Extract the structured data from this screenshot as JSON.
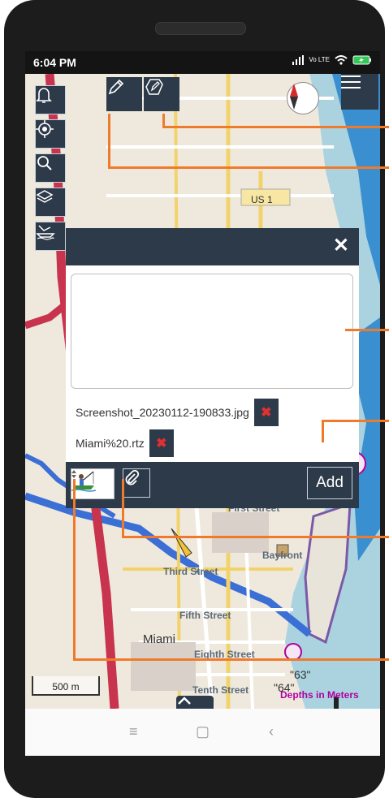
{
  "status_bar": {
    "time": "6:04 PM",
    "network": "Vo LTE",
    "icons": [
      "signal-icon",
      "wifi-icon",
      "battery-charging-icon"
    ]
  },
  "map": {
    "labels": {
      "us1": "US 1",
      "miami": "Miami",
      "third_street": "Third Street",
      "fifth_street": "Fifth Street",
      "eighth_street": "Eighth Street",
      "tenth_street": "Tenth Street",
      "first_street": "First Street",
      "bayfront": "Bayfront",
      "depth_63": "\"63\"",
      "depth_64": "\"64\""
    },
    "scale_label": "500 m",
    "depths_label": "Depths in Meters"
  },
  "toolbar": {
    "left_buttons": [
      "bell-icon",
      "locate-icon",
      "search-icon",
      "layers-icon",
      "boat-ramp-icon"
    ],
    "top_buttons": [
      "pencil-icon",
      "edit-note-icon"
    ],
    "menu": "hamburger-menu-icon",
    "compass": "compass-icon"
  },
  "note_dialog": {
    "close_symbol": "✕",
    "text_value": "",
    "attachments": [
      {
        "name": "Screenshot_20230112-190833.jpg"
      },
      {
        "name": "Miami%20.rtz"
      }
    ],
    "remove_symbol": "✖",
    "add_label": "Add",
    "category_icon": "fishing-boat-icon",
    "attach_icon": "paperclip-icon"
  },
  "nav_bar": {
    "recent": "≡",
    "home": "▢",
    "back": "‹"
  },
  "colors": {
    "panel": "#2d3a4a",
    "callout": "#f07a2c",
    "remove": "#e03030"
  }
}
